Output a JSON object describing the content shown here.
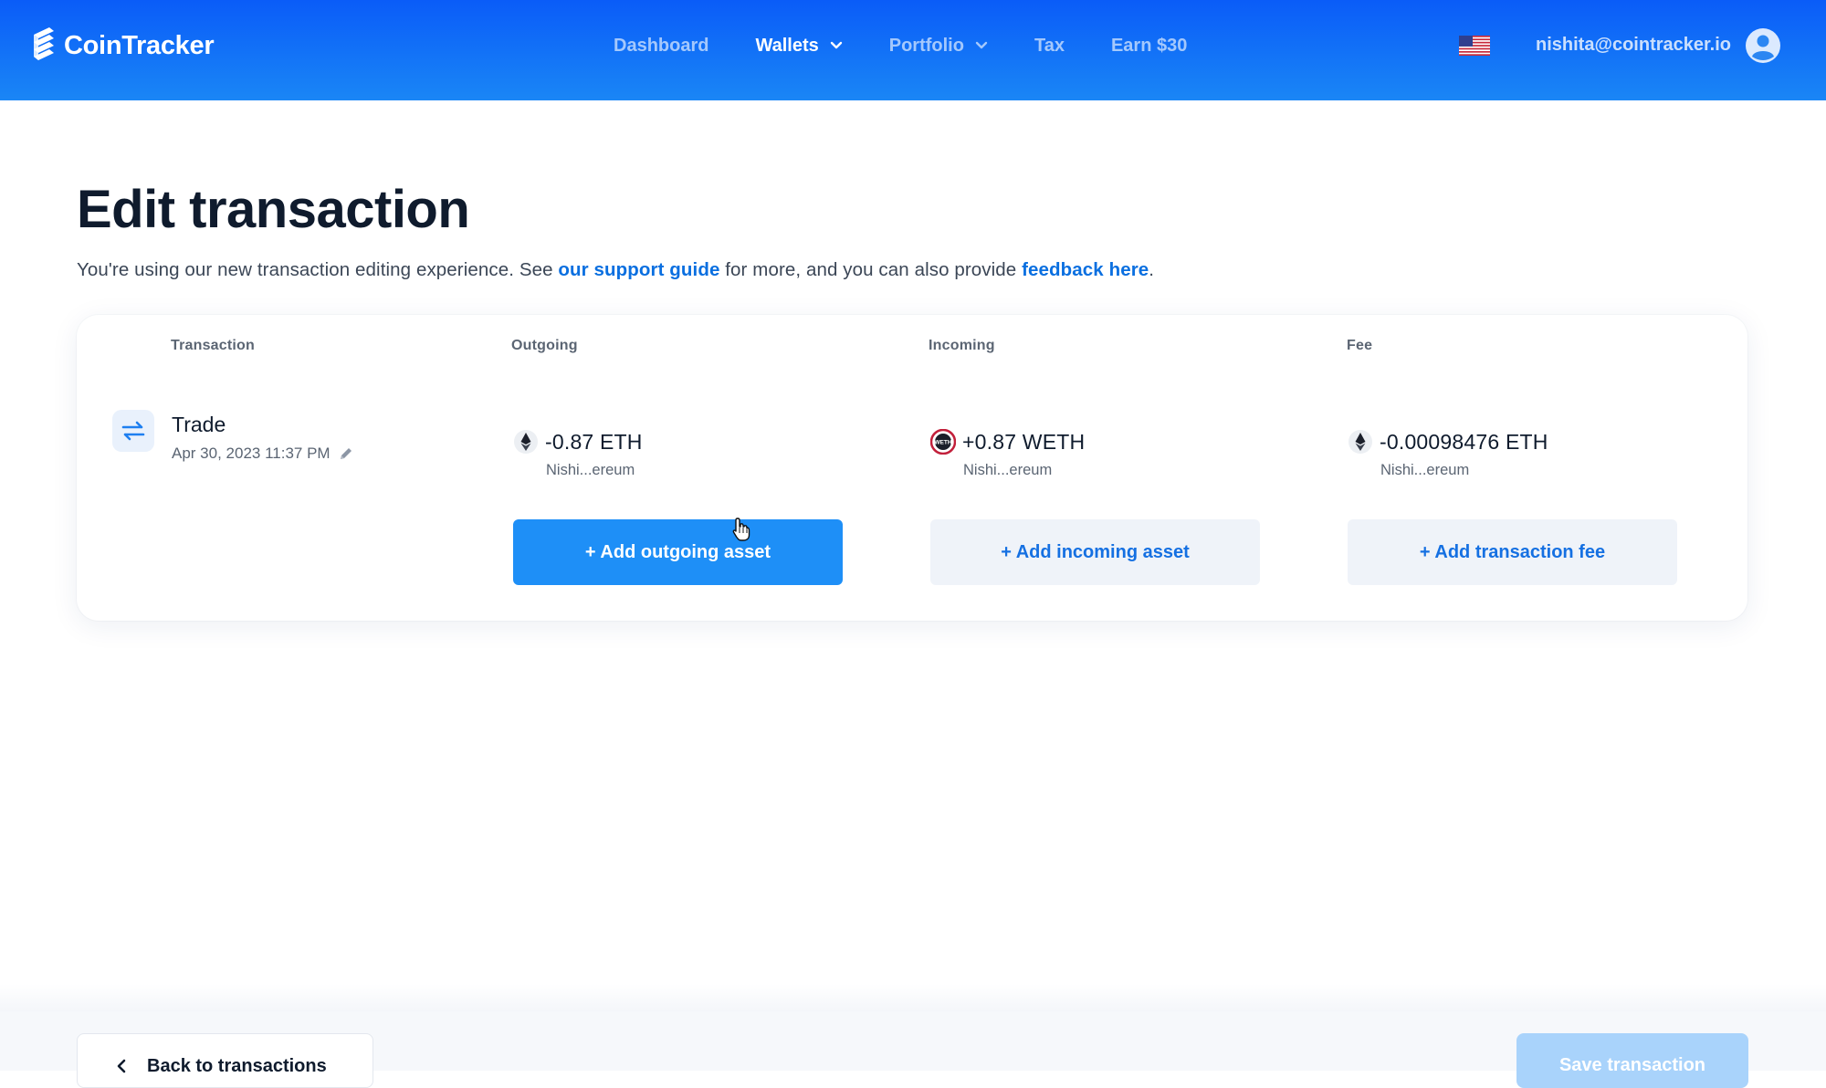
{
  "header": {
    "brand": "CoinTracker",
    "nav": [
      {
        "label": "Dashboard",
        "active": false,
        "dropdown": false
      },
      {
        "label": "Wallets",
        "active": true,
        "dropdown": true
      },
      {
        "label": "Portfolio",
        "active": false,
        "dropdown": true
      },
      {
        "label": "Tax",
        "active": false,
        "dropdown": false
      },
      {
        "label": "Earn $30",
        "active": false,
        "dropdown": false
      }
    ],
    "locale_icon": "us-flag-icon",
    "user_email": "nishita@cointracker.io",
    "avatar_icon": "user-avatar-icon"
  },
  "page": {
    "title": "Edit transaction",
    "intro_prefix": "You're using our new transaction editing experience. See ",
    "support_link": "our support guide",
    "intro_middle": " for more, and you can also provide ",
    "feedback_link": "feedback here",
    "intro_suffix": "."
  },
  "card": {
    "columns": {
      "transaction": "Transaction",
      "outgoing": "Outgoing",
      "incoming": "Incoming",
      "fee": "Fee"
    },
    "transaction": {
      "type": "Trade",
      "type_icon": "swap-arrows-icon",
      "datetime": "Apr 30, 2023 11:37 PM",
      "edit_icon": "pencil-icon"
    },
    "outgoing": {
      "amount": "-0.87 ETH",
      "coin_icon": "eth-icon",
      "wallet": "Nishi...ereum",
      "add_label": "+ Add outgoing asset"
    },
    "incoming": {
      "amount": "+0.87 WETH",
      "coin_icon": "weth-icon",
      "wallet": "Nishi...ereum",
      "add_label": "+ Add incoming asset"
    },
    "fee": {
      "amount": "-0.00098476 ETH",
      "coin_icon": "eth-icon",
      "wallet": "Nishi...ereum",
      "add_label": "+ Add transaction fee"
    }
  },
  "footer": {
    "back_label": "Back to transactions",
    "save_label": "Save transaction"
  },
  "colors": {
    "header_top": "#0a5cf8",
    "header_bottom": "#1a86f6",
    "primary_button": "#1e8ff7",
    "link": "#0a6fe0",
    "save_disabled": "#a9d3fb"
  }
}
